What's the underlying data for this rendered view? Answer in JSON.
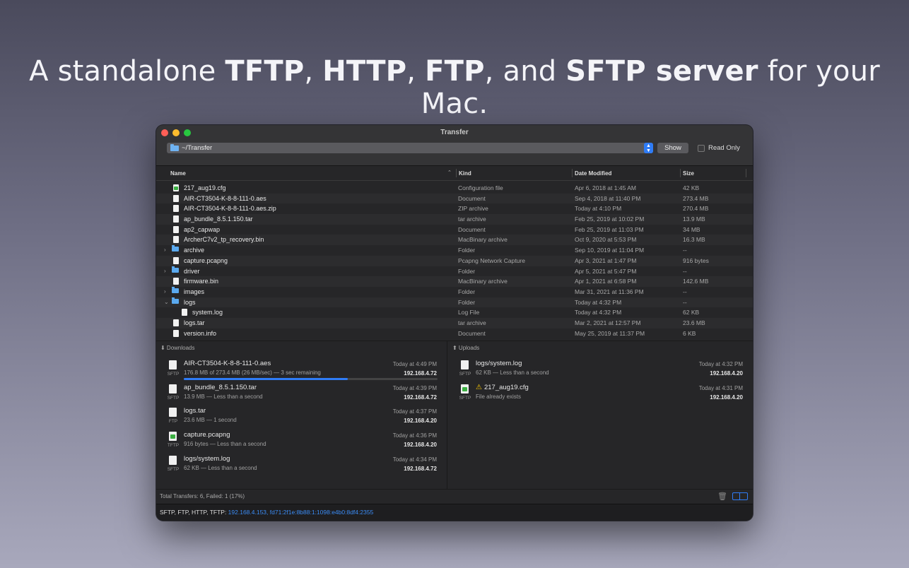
{
  "headline": {
    "p1": "A standalone ",
    "b1": "TFTP",
    "p2": ", ",
    "b2": "HTTP",
    "p3": ", ",
    "b3": "FTP",
    "p4": ", and ",
    "b4": "SFTP server",
    "p5": " for your Mac."
  },
  "window": {
    "title": "Transfer"
  },
  "toolbar": {
    "path": "~/Transfer",
    "show_label": "Show",
    "readonly_label": "Read Only"
  },
  "columns": {
    "name": "Name",
    "kind": "Kind",
    "date": "Date Modified",
    "size": "Size"
  },
  "files": [
    {
      "name": "217_aug19.cfg",
      "kind": "Configuration file",
      "date": "Apr 6, 2018 at 1:45 AM",
      "size": "42 KB",
      "icon": "cfg-file-icon"
    },
    {
      "name": "AIR-CT3504-K-8-8-111-0.aes",
      "kind": "Document",
      "date": "Sep 4, 2018 at 11:40 PM",
      "size": "273.4 MB",
      "icon": "document-icon"
    },
    {
      "name": "AIR-CT3504-K-8-8-111-0.aes.zip",
      "kind": "ZIP archive",
      "date": "Today at 4:10 PM",
      "size": "270.4 MB",
      "icon": "document-icon"
    },
    {
      "name": "ap_bundle_8.5.1.150.tar",
      "kind": "tar archive",
      "date": "Feb 25, 2019 at 10:02 PM",
      "size": "13.9 MB",
      "icon": "document-icon"
    },
    {
      "name": "ap2_capwap",
      "kind": "Document",
      "date": "Feb 25, 2019 at 11:03 PM",
      "size": "34 MB",
      "icon": "document-icon"
    },
    {
      "name": "ArcherC7v2_tp_recovery.bin",
      "kind": "MacBinary archive",
      "date": "Oct 9, 2020 at 5:53 PM",
      "size": "16.3 MB",
      "icon": "document-icon"
    },
    {
      "name": "archive",
      "kind": "Folder",
      "date": "Sep 10, 2019 at 11:04 PM",
      "size": "--",
      "icon": "folder-icon",
      "disclosure": "›"
    },
    {
      "name": "capture.pcapng",
      "kind": "Pcapng Network Capture",
      "date": "Apr 3, 2021 at 1:47 PM",
      "size": "916 bytes",
      "icon": "document-icon"
    },
    {
      "name": "driver",
      "kind": "Folder",
      "date": "Apr 5, 2021 at 5:47 PM",
      "size": "--",
      "icon": "folder-icon",
      "disclosure": "›"
    },
    {
      "name": "firmware.bin",
      "kind": "MacBinary archive",
      "date": "Apr 1, 2021 at 6:58 PM",
      "size": "142.6 MB",
      "icon": "document-icon"
    },
    {
      "name": "images",
      "kind": "Folder",
      "date": "Mar 31, 2021 at 11:36 PM",
      "size": "--",
      "icon": "folder-icon",
      "disclosure": "›"
    },
    {
      "name": "logs",
      "kind": "Folder",
      "date": "Today at 4:32 PM",
      "size": "--",
      "icon": "folder-icon",
      "disclosure": "⌄"
    },
    {
      "name": "system.log",
      "kind": "Log File",
      "date": "Today at 4:32 PM",
      "size": "62 KB",
      "icon": "document-icon",
      "indent": true
    },
    {
      "name": "logs.tar",
      "kind": "tar archive",
      "date": "Mar 2, 2021 at 12:57 PM",
      "size": "23.6 MB",
      "icon": "document-icon"
    },
    {
      "name": "version.info",
      "kind": "Document",
      "date": "May 25, 2019 at 11:37 PM",
      "size": "6 KB",
      "icon": "document-icon"
    }
  ],
  "downloads": {
    "title": "⬇ Downloads",
    "items": [
      {
        "name": "AIR-CT3504-K-8-8-111-0.aes",
        "detail": "176.8 MB of 273.4 MB (26 MB/sec) — 3 sec remaining",
        "time": "Today at 4:49 PM",
        "ip": "192.168.4.72",
        "proto": "SFTP",
        "progress": 0.647
      },
      {
        "name": "ap_bundle_8.5.1.150.tar",
        "detail": "13.9 MB — Less than a second",
        "time": "Today at 4:39 PM",
        "ip": "192.168.4.72",
        "proto": "SFTP"
      },
      {
        "name": "logs.tar",
        "detail": "23.6 MB — 1 second",
        "time": "Today at 4:37 PM",
        "ip": "192.168.4.20",
        "proto": "FTP"
      },
      {
        "name": "capture.pcapng",
        "detail": "916 bytes — Less than a second",
        "time": "Today at 4:36 PM",
        "ip": "192.168.4.20",
        "proto": "TFTP"
      },
      {
        "name": "logs/system.log",
        "detail": "62 KB — Less than a second",
        "time": "Today at 4:34 PM",
        "ip": "192.168.4.72",
        "proto": "SFTP"
      }
    ]
  },
  "uploads": {
    "title": "⬆ Uploads",
    "items": [
      {
        "name": "logs/system.log",
        "detail": "62 KB — Less than a second",
        "time": "Today at 4:32 PM",
        "ip": "192.168.4.20",
        "proto": "SFTP"
      },
      {
        "name": "217_aug19.cfg",
        "detail": "File already exists",
        "time": "Today at 4:31 PM",
        "ip": "192.168.4.20",
        "proto": "SFTP",
        "warning": "⚠"
      }
    ]
  },
  "footer": {
    "summary": "Total Transfers: 6, Failed: 1 (17%)"
  },
  "status": {
    "label": "SFTP, FTP, HTTP, TFTP: ",
    "addresses": "192.168.4.153, fd71:2f1e:8b88:1:1098:e4b0:8df4:2355"
  },
  "colors": {
    "accent": "#2f7cf6",
    "link": "#3b8cf5",
    "warning": "#ffcc00"
  }
}
